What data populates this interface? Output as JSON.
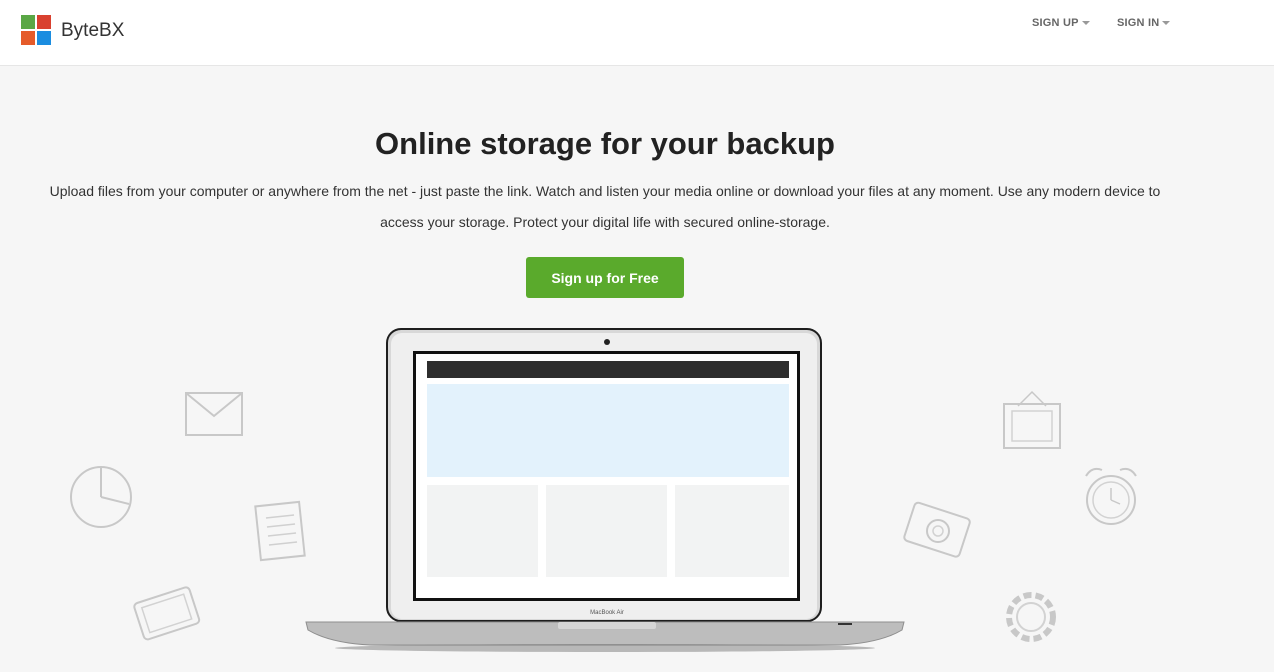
{
  "header": {
    "brand": "ByteBX",
    "nav": {
      "sign_up": "SIGN UP",
      "sign_in": "SIGN IN"
    }
  },
  "hero": {
    "title": "Online storage for your backup",
    "description": "Upload files from your computer or anywhere from the net - just paste the link. Watch and listen your media online or download your files at any moment. Use any modern device to access your storage. Protect your digital life with secured online-storage.",
    "cta_label": "Sign up for Free"
  },
  "illustration": {
    "laptop_label": "MacBook Air"
  },
  "colors": {
    "accent_green": "#5aaa2c",
    "logo": [
      "#5aa745",
      "#d9412f",
      "#e55b2a",
      "#1b8de0"
    ]
  }
}
